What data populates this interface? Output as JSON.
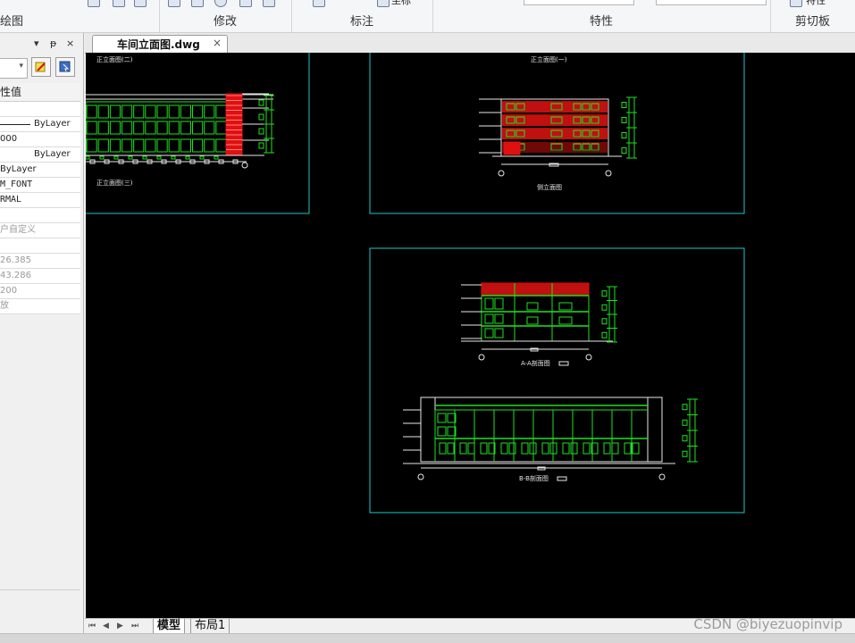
{
  "ribbon": {
    "groups": [
      {
        "label": "绘图"
      },
      {
        "label": "修改"
      },
      {
        "label": "标注"
      },
      {
        "label": "特性"
      },
      {
        "label": "剪切板"
      }
    ],
    "partial_top_text": "坐标",
    "partial_top_right": "特性"
  },
  "left_panel": {
    "close_glyph": "×",
    "pin_glyph": "ᵽ",
    "dropdown_glyph": "▾",
    "select_arrow": "▾",
    "rows": [
      {
        "text": "性值",
        "style": "hdr"
      },
      {
        "text": "",
        "style": "blank"
      },
      {
        "text": "ByLayer",
        "style": "line"
      },
      {
        "text": "000",
        "style": "normal"
      },
      {
        "text": "ByLayer",
        "style": "right"
      },
      {
        "text": "ByLayer",
        "style": "normal"
      },
      {
        "text": "M_FONT",
        "style": "mono"
      },
      {
        "text": "RMAL",
        "style": "mono"
      },
      {
        "text": "",
        "style": "blank"
      },
      {
        "text": "户自定义",
        "style": "gray"
      },
      {
        "text": "",
        "style": "blank"
      },
      {
        "text": "26.385",
        "style": "gray"
      },
      {
        "text": "43.286",
        "style": "gray"
      },
      {
        "text": "200",
        "style": "gray"
      },
      {
        "text": "放",
        "style": "gray"
      }
    ]
  },
  "document_tab": {
    "title": "车间立面图.dwg",
    "close": "×"
  },
  "drawing": {
    "labels": {
      "title_zheng2": "正立面图(二)",
      "title_zheng3": "正立面图(三)",
      "title_zheng1": "正立面图(一)",
      "title_side": "侧立面图",
      "title_aa": "A-A剖面图",
      "title_bb": "B-B剖面图"
    },
    "colors": {
      "frame": "#1ec8c8",
      "green": "#1fe21f",
      "red": "#e01010",
      "white": "#e8e8e8",
      "canvas": "#000000"
    }
  },
  "bottom_tabs": {
    "nav": [
      "⏮",
      "◀",
      "▶",
      "⏭"
    ],
    "model": "模型",
    "layout1": "布局1"
  },
  "watermark": "CSDN @biyezuopinvip"
}
